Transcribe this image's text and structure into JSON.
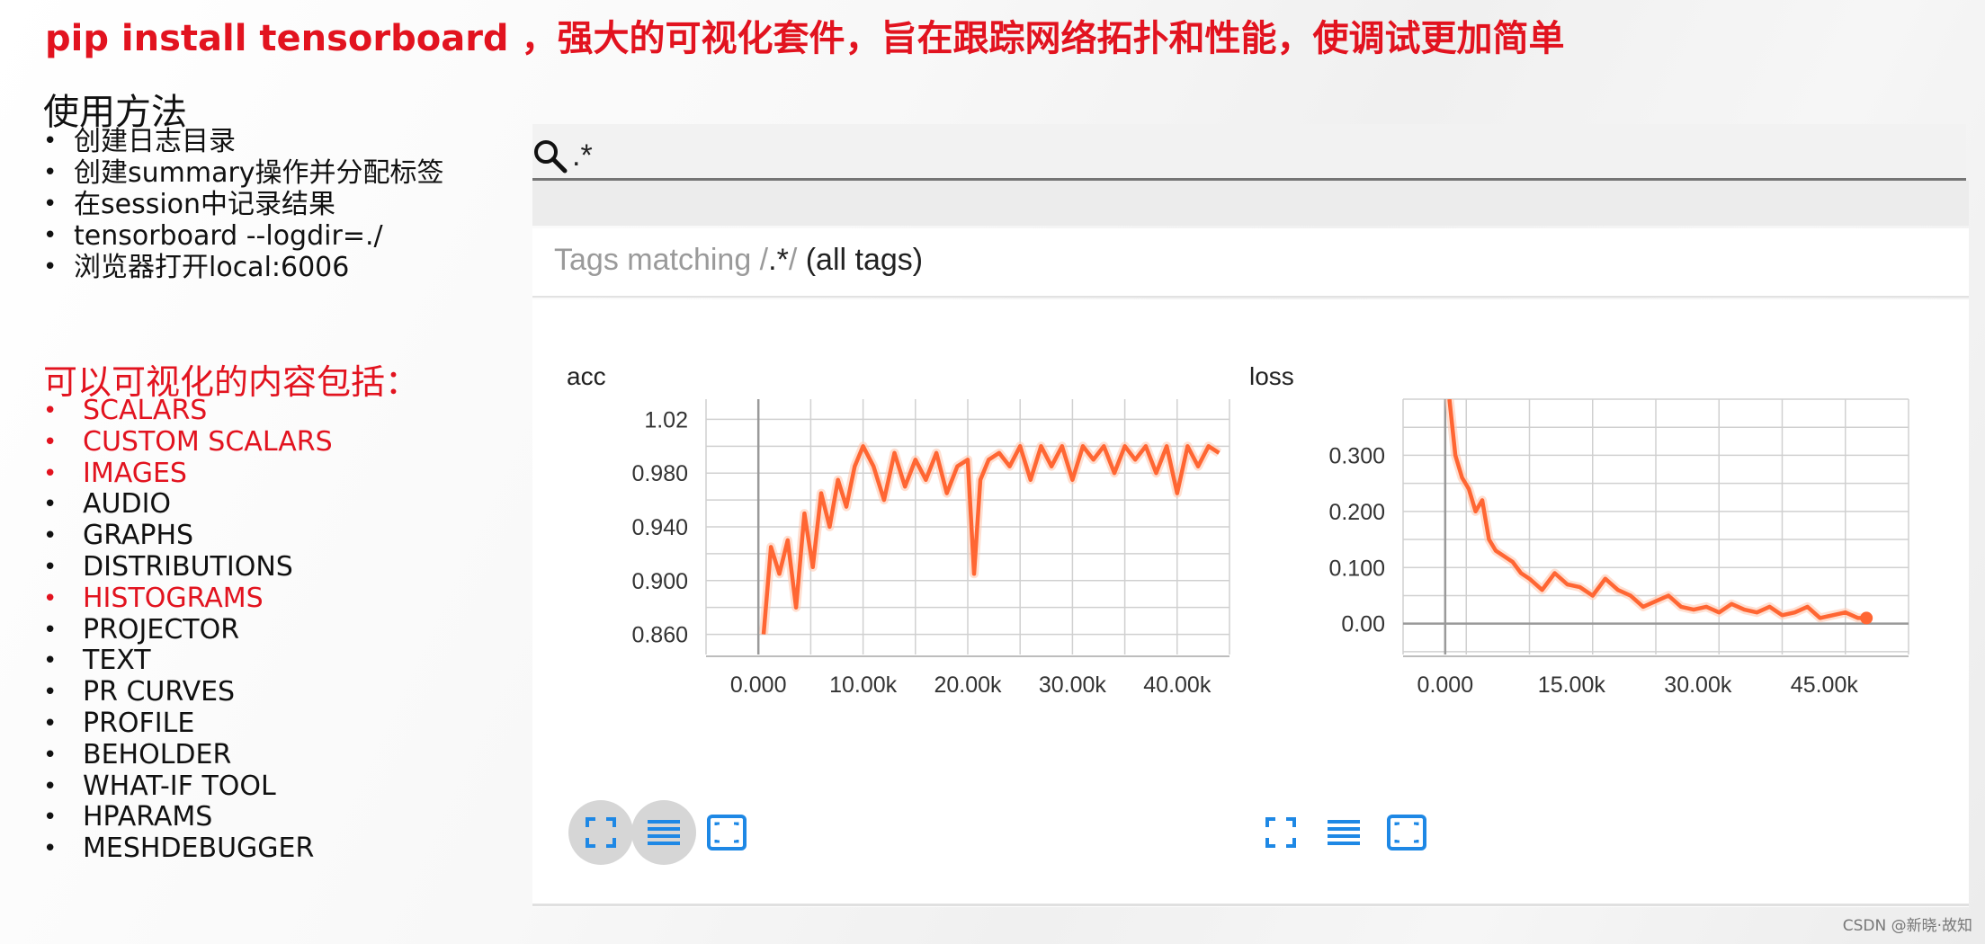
{
  "slide": {
    "title": "pip install tensorboard ，强大的可视化套件，旨在跟踪网络拓扑和性能，使调试更加简单",
    "usage_heading": "使用方法",
    "usage_items": [
      "创建日志目录",
      "创建summary操作并分配标签",
      "在session中记录结果",
      "tensorboard --logdir=./",
      "浏览器打开local:6006"
    ],
    "vis_heading": "可以可视化的内容包括：",
    "vis_items": [
      {
        "label": "SCALARS",
        "highlight": true
      },
      {
        "label": "CUSTOM SCALARS",
        "highlight": true
      },
      {
        "label": "IMAGES",
        "highlight": true
      },
      {
        "label": "AUDIO",
        "highlight": false
      },
      {
        "label": "GRAPHS",
        "highlight": false
      },
      {
        "label": "DISTRIBUTIONS",
        "highlight": false
      },
      {
        "label": "HISTOGRAMS",
        "highlight": true
      },
      {
        "label": "PROJECTOR",
        "highlight": false
      },
      {
        "label": "TEXT",
        "highlight": false
      },
      {
        "label": "PR CURVES",
        "highlight": false
      },
      {
        "label": "PROFILE",
        "highlight": false
      },
      {
        "label": "BEHOLDER",
        "highlight": false
      },
      {
        "label": "WHAT-IF TOOL",
        "highlight": false
      },
      {
        "label": "HPARAMS",
        "highlight": false
      },
      {
        "label": "MESHDEBUGGER",
        "highlight": false
      }
    ],
    "watermark": "CSDN @新晓·故知"
  },
  "tensorboard": {
    "search_value": ".*",
    "search_icon": "search-icon",
    "tags_prefix": "Tags matching /",
    "tags_regex": ".*",
    "tags_suffix": "/",
    "tags_all": "(all tags)",
    "controls": [
      "fullscreen-icon",
      "list-icon",
      "fit-domain-icon"
    ]
  },
  "colors": {
    "title_red": "#e2131f",
    "series": "#ff6633",
    "series_faint": "#ffc9b3",
    "axis": "#9a9a9a",
    "grid": "#d0d0d0",
    "control_blue": "#1e88e5"
  },
  "chart_data": [
    {
      "type": "line",
      "title": "acc",
      "xlabel": "",
      "ylabel": "",
      "xlim": [
        -5000,
        45000
      ],
      "ylim": [
        0.845,
        1.035
      ],
      "xticks": [
        0,
        10000,
        20000,
        30000,
        40000
      ],
      "xtick_labels": [
        "0.000",
        "10.00k",
        "20.00k",
        "30.00k",
        "40.00k"
      ],
      "yticks": [
        0.86,
        0.9,
        0.94,
        0.98,
        1.02
      ],
      "ytick_labels": [
        "0.860",
        "0.900",
        "0.940",
        "0.980",
        "1.02"
      ],
      "grid": true,
      "x": [
        500,
        1200,
        2000,
        2800,
        3600,
        4400,
        5200,
        6000,
        6800,
        7600,
        8400,
        9200,
        10000,
        11000,
        12000,
        13000,
        14000,
        15000,
        16000,
        17000,
        18000,
        19000,
        20000,
        20600,
        21200,
        22000,
        23000,
        24000,
        25000,
        26000,
        27000,
        28000,
        29000,
        30000,
        31000,
        32000,
        33000,
        34000,
        35000,
        36000,
        37000,
        38000,
        39000,
        40000,
        41000,
        42000,
        43000,
        44000
      ],
      "series": [
        {
          "values": [
            0.86,
            0.925,
            0.905,
            0.93,
            0.88,
            0.95,
            0.91,
            0.965,
            0.94,
            0.975,
            0.955,
            0.985,
            1.0,
            0.985,
            0.96,
            0.995,
            0.97,
            0.99,
            0.975,
            0.995,
            0.965,
            0.985,
            0.99,
            0.905,
            0.975,
            0.99,
            0.995,
            0.985,
            1.0,
            0.975,
            1.0,
            0.985,
            1.0,
            0.975,
            1.0,
            0.99,
            1.0,
            0.98,
            1.0,
            0.99,
            1.0,
            0.98,
            1.0,
            0.965,
            1.0,
            0.985,
            1.0,
            0.995
          ]
        }
      ]
    },
    {
      "type": "line",
      "title": "loss",
      "xlabel": "",
      "ylabel": "",
      "xlim": [
        -5000,
        55000
      ],
      "ylim": [
        -0.055,
        0.4
      ],
      "xticks": [
        0,
        15000,
        30000,
        45000
      ],
      "xtick_labels": [
        "0.000",
        "15.00k",
        "30.00k",
        "45.00k"
      ],
      "yticks": [
        0.0,
        0.1,
        0.2,
        0.3
      ],
      "ytick_labels": [
        "0.00",
        "0.100",
        "0.200",
        "0.300"
      ],
      "grid": true,
      "x": [
        500,
        1200,
        2000,
        2800,
        3600,
        4400,
        5200,
        6000,
        7000,
        8000,
        9000,
        10000,
        11500,
        13000,
        14500,
        16000,
        17500,
        19000,
        20500,
        22000,
        23500,
        25000,
        26500,
        28000,
        29500,
        31000,
        32500,
        34000,
        35500,
        37000,
        38500,
        40000,
        41500,
        43000,
        44500,
        46000,
        47500,
        49000,
        50000
      ],
      "series": [
        {
          "values": [
            0.4,
            0.3,
            0.26,
            0.24,
            0.2,
            0.22,
            0.15,
            0.13,
            0.12,
            0.11,
            0.09,
            0.08,
            0.06,
            0.09,
            0.07,
            0.065,
            0.05,
            0.08,
            0.06,
            0.05,
            0.03,
            0.04,
            0.05,
            0.03,
            0.025,
            0.03,
            0.02,
            0.035,
            0.025,
            0.02,
            0.03,
            0.015,
            0.02,
            0.03,
            0.01,
            0.015,
            0.02,
            0.01,
            0.01
          ]
        }
      ]
    }
  ]
}
